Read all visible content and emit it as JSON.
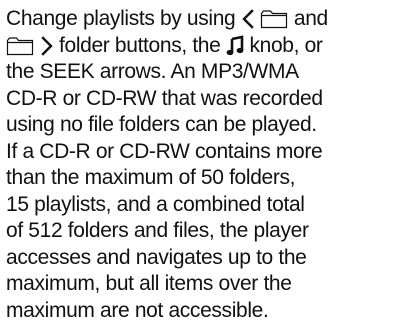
{
  "document": {
    "line1": {
      "text_a": "Change playlists by using",
      "text_b": "and"
    },
    "line2": {
      "text_a": "folder buttons, the",
      "text_b": "knob, or"
    },
    "line3": "the SEEK arrows. An MP3/WMA",
    "line4": "CD-R or CD-RW that was recorded",
    "line5": "using no file folders can be played.",
    "line6": "If a CD-R or CD-RW contains more",
    "line7": "than the maximum of 50 folders,",
    "line8": "15 playlists, and a combined total",
    "line9": "of 512 folders and files, the player",
    "line10": "accesses and navigates up to the",
    "line11": "maximum, but all items over the",
    "line12": "maximum are not accessible."
  },
  "icons": {
    "left_chevron": "chevron-left-icon",
    "folder_1": "folder-icon",
    "folder_2": "folder-icon",
    "right_chevron": "chevron-right-icon",
    "music_note": "music-note-icon"
  },
  "colors": {
    "text": "#111111",
    "icon": "#111111",
    "background": "#ffffff"
  }
}
